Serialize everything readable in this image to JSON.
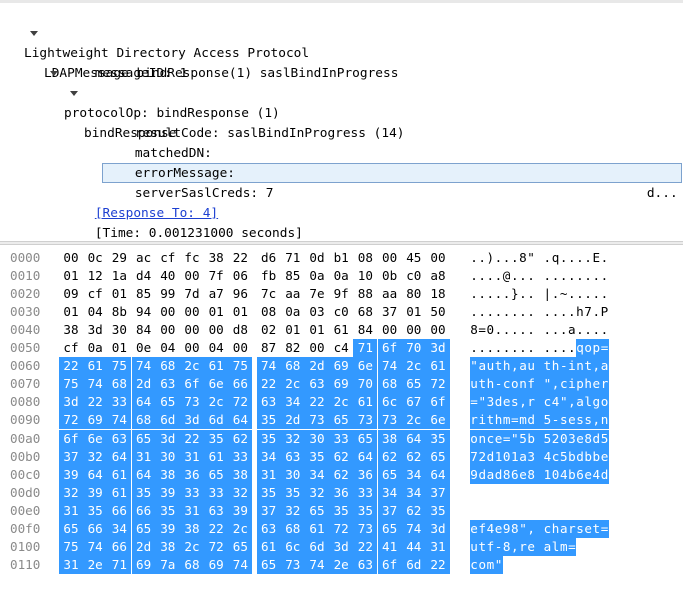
{
  "tree": {
    "rows": [
      {
        "text": "Lightweight Directory Access Protocol",
        "expanded": true
      },
      {
        "text": "LDAPMessage bindResponse(1) saslBindInProgress",
        "expanded": true
      },
      {
        "text": "messageID: 1"
      },
      {
        "text": "protocolOp: bindResponse (1)",
        "expanded": true
      },
      {
        "text": "bindResponse",
        "expanded": true
      },
      {
        "text": "resultCode: saslBindInProgress (14)"
      },
      {
        "text": "matchedDN:"
      },
      {
        "text": "errorMessage:"
      },
      {
        "text": "serverSaslCreds: 7",
        "selected": true,
        "trailing": "d..."
      },
      {
        "text": "[Response To: 4]",
        "link": true
      },
      {
        "text": "[Time: 0.001231000 seconds]"
      }
    ]
  },
  "hex": {
    "rows": [
      {
        "offset": "0000",
        "bytes": [
          "00",
          "0c",
          "29",
          "ac",
          "cf",
          "fc",
          "38",
          "22",
          "d6",
          "71",
          "0d",
          "b1",
          "08",
          "00",
          "45",
          "00"
        ],
        "ascii": "..)...8\" .q....E."
      },
      {
        "offset": "0010",
        "bytes": [
          "01",
          "12",
          "1a",
          "d4",
          "40",
          "00",
          "7f",
          "06",
          "fb",
          "85",
          "0a",
          "0a",
          "10",
          "0b",
          "c0",
          "a8"
        ],
        "ascii": "....@... ........"
      },
      {
        "offset": "0020",
        "bytes": [
          "09",
          "cf",
          "01",
          "85",
          "99",
          "7d",
          "a7",
          "96",
          "7c",
          "aa",
          "7e",
          "9f",
          "88",
          "aa",
          "80",
          "18"
        ],
        "ascii": ".....}.. |.~....."
      },
      {
        "offset": "0030",
        "bytes": [
          "01",
          "04",
          "8b",
          "94",
          "00",
          "00",
          "01",
          "01",
          "08",
          "0a",
          "03",
          "c0",
          "68",
          "37",
          "01",
          "50"
        ],
        "ascii": "........ ....h7.P"
      },
      {
        "offset": "0040",
        "bytes": [
          "38",
          "3d",
          "30",
          "84",
          "00",
          "00",
          "00",
          "d8",
          "02",
          "01",
          "01",
          "61",
          "84",
          "00",
          "00",
          "00"
        ],
        "ascii": "8=0..... ...a...."
      },
      {
        "offset": "0050",
        "bytes": [
          "cf",
          "0a",
          "01",
          "0e",
          "04",
          "00",
          "04",
          "00",
          "87",
          "82",
          "00",
          "c4",
          "71",
          "6f",
          "70",
          "3d"
        ],
        "ascii": "........ ....qop="
      },
      {
        "offset": "0060",
        "bytes": [
          "22",
          "61",
          "75",
          "74",
          "68",
          "2c",
          "61",
          "75",
          "74",
          "68",
          "2d",
          "69",
          "6e",
          "74",
          "2c",
          "61"
        ],
        "ascii": "\"auth,au th-int,a"
      },
      {
        "offset": "0070",
        "bytes": [
          "75",
          "74",
          "68",
          "2d",
          "63",
          "6f",
          "6e",
          "66",
          "22",
          "2c",
          "63",
          "69",
          "70",
          "68",
          "65",
          "72"
        ],
        "ascii": "uth-conf \",cipher"
      },
      {
        "offset": "0080",
        "bytes": [
          "3d",
          "22",
          "33",
          "64",
          "65",
          "73",
          "2c",
          "72",
          "63",
          "34",
          "22",
          "2c",
          "61",
          "6c",
          "67",
          "6f"
        ],
        "ascii": "=\"3des,r c4\",algo"
      },
      {
        "offset": "0090",
        "bytes": [
          "72",
          "69",
          "74",
          "68",
          "6d",
          "3d",
          "6d",
          "64",
          "35",
          "2d",
          "73",
          "65",
          "73",
          "73",
          "2c",
          "6e"
        ],
        "ascii": "rithm=md 5-sess,n"
      },
      {
        "offset": "00a0",
        "bytes": [
          "6f",
          "6e",
          "63",
          "65",
          "3d",
          "22",
          "35",
          "62",
          "35",
          "32",
          "30",
          "33",
          "65",
          "38",
          "64",
          "35"
        ],
        "ascii": "once=\"5b 5203e8d5"
      },
      {
        "offset": "00b0",
        "bytes": [
          "37",
          "32",
          "64",
          "31",
          "30",
          "31",
          "61",
          "33",
          "34",
          "63",
          "35",
          "62",
          "64",
          "62",
          "62",
          "65"
        ],
        "ascii": "72d101a3 4c5bdbbe"
      },
      {
        "offset": "00c0",
        "bytes": [
          "39",
          "64",
          "61",
          "64",
          "38",
          "36",
          "65",
          "38",
          "31",
          "30",
          "34",
          "62",
          "36",
          "65",
          "34",
          "64"
        ],
        "ascii": "9dad86e8 104b6e4d"
      },
      {
        "offset": "00d0",
        "bytes": [
          "32",
          "39",
          "61",
          "35",
          "39",
          "33",
          "33",
          "32",
          "35",
          "35",
          "32",
          "36",
          "33",
          "34",
          "34",
          "37"
        ],
        "ascii": ""
      },
      {
        "offset": "00e0",
        "bytes": [
          "31",
          "35",
          "66",
          "66",
          "35",
          "31",
          "63",
          "39",
          "37",
          "32",
          "65",
          "35",
          "35",
          "37",
          "62",
          "35"
        ],
        "ascii": ""
      },
      {
        "offset": "00f0",
        "bytes": [
          "65",
          "66",
          "34",
          "65",
          "39",
          "38",
          "22",
          "2c",
          "63",
          "68",
          "61",
          "72",
          "73",
          "65",
          "74",
          "3d"
        ],
        "ascii": "ef4e98\", charset="
      },
      {
        "offset": "0100",
        "bytes": [
          "75",
          "74",
          "66",
          "2d",
          "38",
          "2c",
          "72",
          "65",
          "61",
          "6c",
          "6d",
          "3d",
          "22",
          "41",
          "44",
          "31"
        ],
        "ascii": "utf-8,re alm="
      },
      {
        "offset": "0110",
        "bytes": [
          "31",
          "2e",
          "71",
          "69",
          "7a",
          "68",
          "69",
          "74",
          "65",
          "73",
          "74",
          "2e",
          "63",
          "6f",
          "6d",
          "22"
        ],
        "ascii": "com\""
      }
    ],
    "highlight_start_row": 5,
    "highlight_start_byte": 12,
    "selection_color": "#3399ff"
  }
}
